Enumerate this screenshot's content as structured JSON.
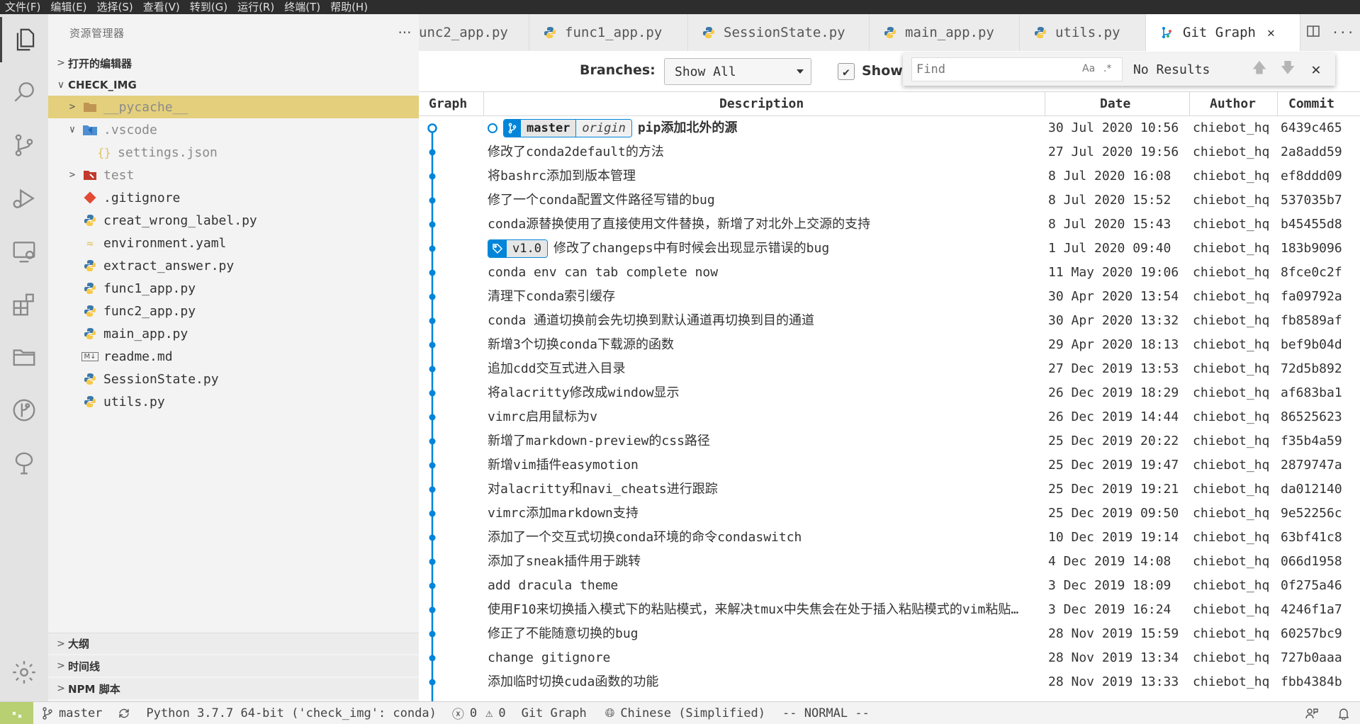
{
  "menu": [
    "文件(F)",
    "编辑(E)",
    "选择(S)",
    "查看(V)",
    "转到(G)",
    "运行(R)",
    "终端(T)",
    "帮助(H)"
  ],
  "activity_icons": [
    "explorer-icon",
    "search-icon",
    "source-control-icon",
    "run-debug-icon",
    "remote-explorer-icon",
    "extensions-icon",
    "folder-icon",
    "git-graph-icon",
    "tree-icon",
    "settings-gear-icon"
  ],
  "sidebar": {
    "title": "资源管理器",
    "more": "···",
    "open_editors": "打开的编辑器",
    "folder": "CHECK_IMG",
    "items": [
      {
        "label": "__pycache__",
        "icon": "folder-icon"
      },
      {
        "label": ".vscode",
        "icon": "vscode-folder-icon"
      },
      {
        "label": "settings.json",
        "icon": "json-icon"
      },
      {
        "label": "test",
        "icon": "test-folder-icon"
      },
      {
        "label": ".gitignore",
        "icon": "git-file-icon"
      },
      {
        "label": "creat_wrong_label.py",
        "icon": "python-icon"
      },
      {
        "label": "environment.yaml",
        "icon": "yaml-icon"
      },
      {
        "label": "extract_answer.py",
        "icon": "python-icon"
      },
      {
        "label": "func1_app.py",
        "icon": "python-icon"
      },
      {
        "label": "func2_app.py",
        "icon": "python-icon"
      },
      {
        "label": "main_app.py",
        "icon": "python-icon"
      },
      {
        "label": "readme.md",
        "icon": "markdown-icon"
      },
      {
        "label": "SessionState.py",
        "icon": "python-icon"
      },
      {
        "label": "utils.py",
        "icon": "python-icon"
      }
    ],
    "outline": "大纲",
    "timeline": "时间线",
    "npm": "NPM 脚本"
  },
  "tabs": [
    {
      "label": "unc2_app.py",
      "icon": "python-icon",
      "active": false
    },
    {
      "label": "func1_app.py",
      "icon": "python-icon",
      "active": false
    },
    {
      "label": "SessionState.py",
      "icon": "python-icon",
      "active": false
    },
    {
      "label": "main_app.py",
      "icon": "python-icon",
      "active": false
    },
    {
      "label": "utils.py",
      "icon": "python-icon",
      "active": false
    },
    {
      "label": "Git Graph",
      "icon": "git-graph-icon",
      "active": true
    }
  ],
  "gitgraph": {
    "branches_label": "Branches:",
    "branch_value": "Show All",
    "show_label": "Show",
    "show_checked": true,
    "find": {
      "placeholder": "Find",
      "case_option": "Aa",
      "regex_option": ".*",
      "results": "No Results"
    },
    "columns": {
      "graph": "Graph",
      "description": "Description",
      "date": "Date",
      "author": "Author",
      "commit": "Commit"
    },
    "head_ref": {
      "branch": "master",
      "remote": "origin"
    },
    "tag_ref": "v1.0",
    "accent": "#0085d9",
    "commits": [
      {
        "desc": "pip添加北外的源",
        "date": "30 Jul 2020 10:56",
        "author": "chiebot_hq",
        "hash": "6439c465"
      },
      {
        "desc": "修改了conda2default的方法",
        "date": "27 Jul 2020 19:56",
        "author": "chiebot_hq",
        "hash": "2a8add59"
      },
      {
        "desc": "将bashrc添加到版本管理",
        "date": "8 Jul 2020 16:08",
        "author": "chiebot_hq",
        "hash": "ef8ddd09"
      },
      {
        "desc": "修了一个conda配置文件路径写错的bug",
        "date": "8 Jul 2020 15:52",
        "author": "chiebot_hq",
        "hash": "537035b7"
      },
      {
        "desc": "conda源替换使用了直接使用文件替换，新增了对北外上交源的支持",
        "date": "8 Jul 2020 15:43",
        "author": "chiebot_hq",
        "hash": "b45455d8"
      },
      {
        "desc": "修改了changeps中有时候会出现显示错误的bug",
        "date": "1 Jul 2020 09:40",
        "author": "chiebot_hq",
        "hash": "183b9096"
      },
      {
        "desc": "conda env can tab complete now",
        "date": "11 May 2020 19:06",
        "author": "chiebot_hq",
        "hash": "8fce0c2f"
      },
      {
        "desc": "清理下conda索引缓存",
        "date": "30 Apr 2020 13:54",
        "author": "chiebot_hq",
        "hash": "fa09792a"
      },
      {
        "desc": "conda 通道切换前会先切换到默认通道再切换到目的通道",
        "date": "30 Apr 2020 13:32",
        "author": "chiebot_hq",
        "hash": "fb8589af"
      },
      {
        "desc": "新增3个切换conda下载源的函数",
        "date": "29 Apr 2020 18:13",
        "author": "chiebot_hq",
        "hash": "bef9b04d"
      },
      {
        "desc": "追加cdd交互式进入目录",
        "date": "27 Dec 2019 13:53",
        "author": "chiebot_hq",
        "hash": "72d5b892"
      },
      {
        "desc": "将alacritty修改成window显示",
        "date": "26 Dec 2019 18:29",
        "author": "chiebot_hq",
        "hash": "af683ba1"
      },
      {
        "desc": "vimrc启用鼠标为v",
        "date": "26 Dec 2019 14:44",
        "author": "chiebot_hq",
        "hash": "86525623"
      },
      {
        "desc": "新增了markdown-preview的css路径",
        "date": "25 Dec 2019 20:22",
        "author": "chiebot_hq",
        "hash": "f35b4a59"
      },
      {
        "desc": "新增vim插件easymotion",
        "date": "25 Dec 2019 19:47",
        "author": "chiebot_hq",
        "hash": "2879747a"
      },
      {
        "desc": "对alacritty和navi_cheats进行跟踪",
        "date": "25 Dec 2019 19:21",
        "author": "chiebot_hq",
        "hash": "da012140"
      },
      {
        "desc": "vimrc添加markdown支持",
        "date": "25 Dec 2019 09:50",
        "author": "chiebot_hq",
        "hash": "9e52256c"
      },
      {
        "desc": "添加了一个交互式切换conda环境的命令condaswitch",
        "date": "10 Dec 2019 19:14",
        "author": "chiebot_hq",
        "hash": "63bf41c8"
      },
      {
        "desc": "添加了sneak插件用于跳转",
        "date": "4 Dec 2019 14:08",
        "author": "chiebot_hq",
        "hash": "066d1958"
      },
      {
        "desc": "add dracula theme",
        "date": "3 Dec 2019 18:09",
        "author": "chiebot_hq",
        "hash": "0f275a46"
      },
      {
        "desc": "使用F10来切换插入模式下的粘贴模式，来解决tmux中失焦会在处于插入粘贴模式的vim粘贴…",
        "date": "3 Dec 2019 16:24",
        "author": "chiebot_hq",
        "hash": "4246f1a7"
      },
      {
        "desc": "修正了不能随意切换的bug",
        "date": "28 Nov 2019 15:59",
        "author": "chiebot_hq",
        "hash": "60257bc9"
      },
      {
        "desc": "change gitignore",
        "date": "28 Nov 2019 13:34",
        "author": "chiebot_hq",
        "hash": "727b0aaa"
      },
      {
        "desc": "添加临时切换cuda函数的功能",
        "date": "28 Nov 2019 13:33",
        "author": "chiebot_hq",
        "hash": "fbb4384b"
      }
    ]
  },
  "statusbar": {
    "branch": "master",
    "python": "Python 3.7.7 64-bit ('check_img': conda)",
    "errors": "0",
    "warnings": "0",
    "gitgraph": "Git Graph",
    "language": "Chinese (Simplified)",
    "mode": "-- NORMAL --"
  }
}
